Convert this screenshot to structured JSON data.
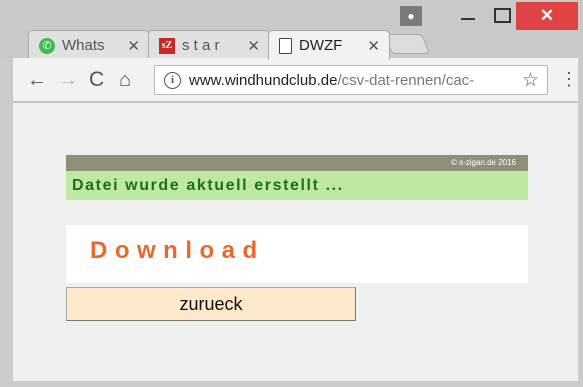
{
  "tabs": [
    {
      "title": "Whats",
      "icon": "whatsapp-icon",
      "active": false
    },
    {
      "title": "s t a r",
      "icon": "stz-icon",
      "active": false
    },
    {
      "title": "DWZF",
      "icon": "document-icon",
      "active": true
    }
  ],
  "tab_close_glyph": "✕",
  "window_controls": {
    "close_glyph": "✕"
  },
  "toolbar": {
    "back_glyph": "←",
    "forward_glyph": "→",
    "reload_glyph": "C",
    "home_glyph": "⌂",
    "menu_glyph": "⋮",
    "star_glyph": "☆"
  },
  "address": {
    "domain": "www.windhundclub.de",
    "path": "/csv-dat-rennen/cac-"
  },
  "page": {
    "copyright": "© s-zigan.de 2016",
    "status": "Datei wurde aktuell erstellt ...",
    "download_label": "Download",
    "back_label": "zurueck"
  },
  "colors": {
    "status_bg": "#bde9a4",
    "status_text": "#1f6e1c",
    "download_text": "#e8692c",
    "button_bg": "#fde8cb",
    "close_button": "#e04343"
  }
}
